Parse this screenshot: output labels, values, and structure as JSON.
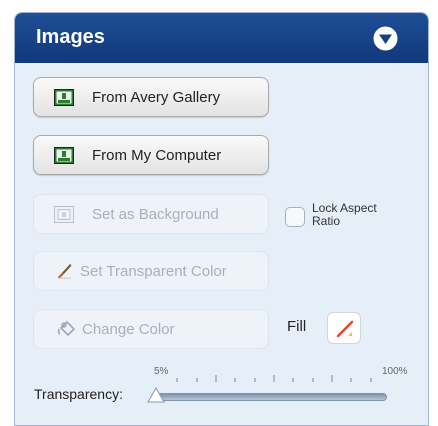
{
  "panel": {
    "title": "Images",
    "collapse_icon": "chevron-down-circle-icon"
  },
  "buttons": {
    "avery_gallery": {
      "label": "From Avery Gallery",
      "icon": "image-icon",
      "enabled": true
    },
    "my_computer": {
      "label": "From My Computer",
      "icon": "image-icon",
      "enabled": true
    },
    "set_background": {
      "label": "Set as Background",
      "icon": "background-image-icon",
      "enabled": false
    },
    "set_transparent": {
      "label": "Set Transparent Color",
      "icon": "eyedropper-icon",
      "enabled": false
    },
    "change_color": {
      "label": "Change Color",
      "icon": "paint-bucket-icon",
      "enabled": false
    }
  },
  "lock_aspect": {
    "label_line1": "Lock Aspect",
    "label_line2": "Ratio",
    "checked": false
  },
  "fill": {
    "label": "Fill",
    "icon": "no-fill-icon"
  },
  "transparency": {
    "label": "Transparency:",
    "min_label": "5%",
    "max_label": "100%",
    "value_percent": 5
  },
  "colors": {
    "header": "#1a4589",
    "panel_bg": "#e6eef8",
    "no_fill_red": "#e8443a"
  }
}
